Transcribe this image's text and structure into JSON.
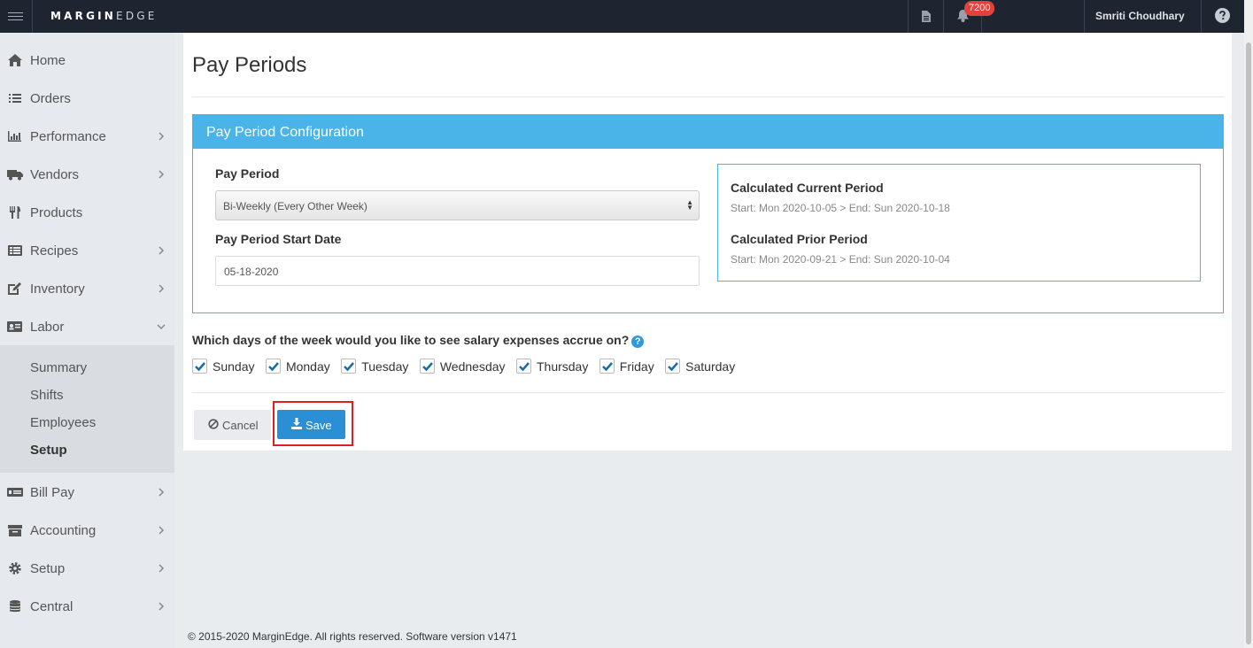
{
  "header": {
    "brand_bold": "MARGIN",
    "brand_light": "EDGE",
    "notification_count": "7200",
    "user_name": "Smriti Choudhary"
  },
  "sidebar": {
    "items": [
      {
        "label": "Home",
        "icon": "home-icon"
      },
      {
        "label": "Orders",
        "icon": "list-icon"
      },
      {
        "label": "Performance",
        "icon": "bar-chart-icon"
      },
      {
        "label": "Vendors",
        "icon": "truck-icon"
      },
      {
        "label": "Products",
        "icon": "cutlery-icon"
      },
      {
        "label": "Recipes",
        "icon": "recipe-icon"
      },
      {
        "label": "Inventory",
        "icon": "edit-icon"
      },
      {
        "label": "Labor",
        "icon": "id-card-icon"
      },
      {
        "label": "Bill Pay",
        "icon": "money-icon"
      },
      {
        "label": "Accounting",
        "icon": "archive-icon"
      },
      {
        "label": "Setup",
        "icon": "gear-icon"
      },
      {
        "label": "Central",
        "icon": "database-icon"
      }
    ],
    "labor_sub": [
      "Summary",
      "Shifts",
      "Employees",
      "Setup"
    ]
  },
  "main": {
    "title": "Pay Periods",
    "config": {
      "heading": "Pay Period Configuration",
      "pay_period_label": "Pay Period",
      "pay_period_value": "Bi-Weekly (Every Other Week)",
      "start_date_label": "Pay Period Start Date",
      "start_date_value": "05-18-2020",
      "current_title": "Calculated Current Period",
      "current_range": "Start: Mon 2020-10-05 > End: Sun 2020-10-18",
      "prior_title": "Calculated Prior Period",
      "prior_range": "Start: Mon 2020-09-21 > End: Sun 2020-10-04"
    },
    "question": "Which days of the week would you like to see salary expenses accrue on?",
    "days": [
      "Sunday",
      "Monday",
      "Tuesday",
      "Wednesday",
      "Thursday",
      "Friday",
      "Saturday"
    ],
    "cancel_label": "Cancel",
    "save_label": "Save"
  },
  "footer": "© 2015-2020 MarginEdge. All rights reserved. Software version v1471",
  "colors": {
    "topbar": "#1e2430",
    "accent": "#4ab3e8",
    "save": "#2b8fd6",
    "highlight": "#e02020"
  }
}
